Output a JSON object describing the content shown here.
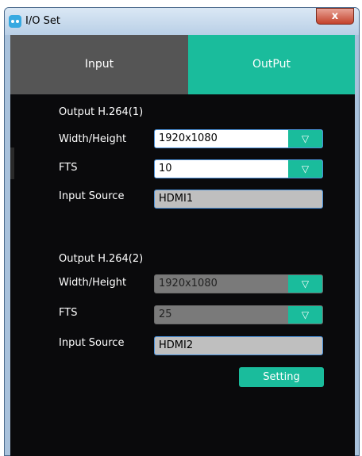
{
  "window": {
    "title": "I/O Set",
    "close_glyph": "x",
    "icon": "app-logo-icon"
  },
  "tabs": [
    {
      "label": "Input",
      "active": false
    },
    {
      "label": "OutPut",
      "active": true
    }
  ],
  "outputs": [
    {
      "title": "Output H.264(1)",
      "width_height_label": "Width/Height",
      "width_height_value": "1920x1080",
      "fts_label": "FTS",
      "fts_value": "10",
      "input_source_label": "Input Source",
      "input_source_value": "HDMI1"
    },
    {
      "title": "Output H.264(2)",
      "width_height_label": "Width/Height",
      "width_height_value": "1920x1080",
      "fts_label": "FTS",
      "fts_value": "25",
      "input_source_label": "Input Source",
      "input_source_value": "HDMI2"
    }
  ],
  "setting_button": {
    "label": "Setting"
  },
  "dropdown_glyph": "▽",
  "colors": {
    "accent": "#1abc9c",
    "background": "#0a0a0c",
    "inactive_tab": "#555555"
  }
}
